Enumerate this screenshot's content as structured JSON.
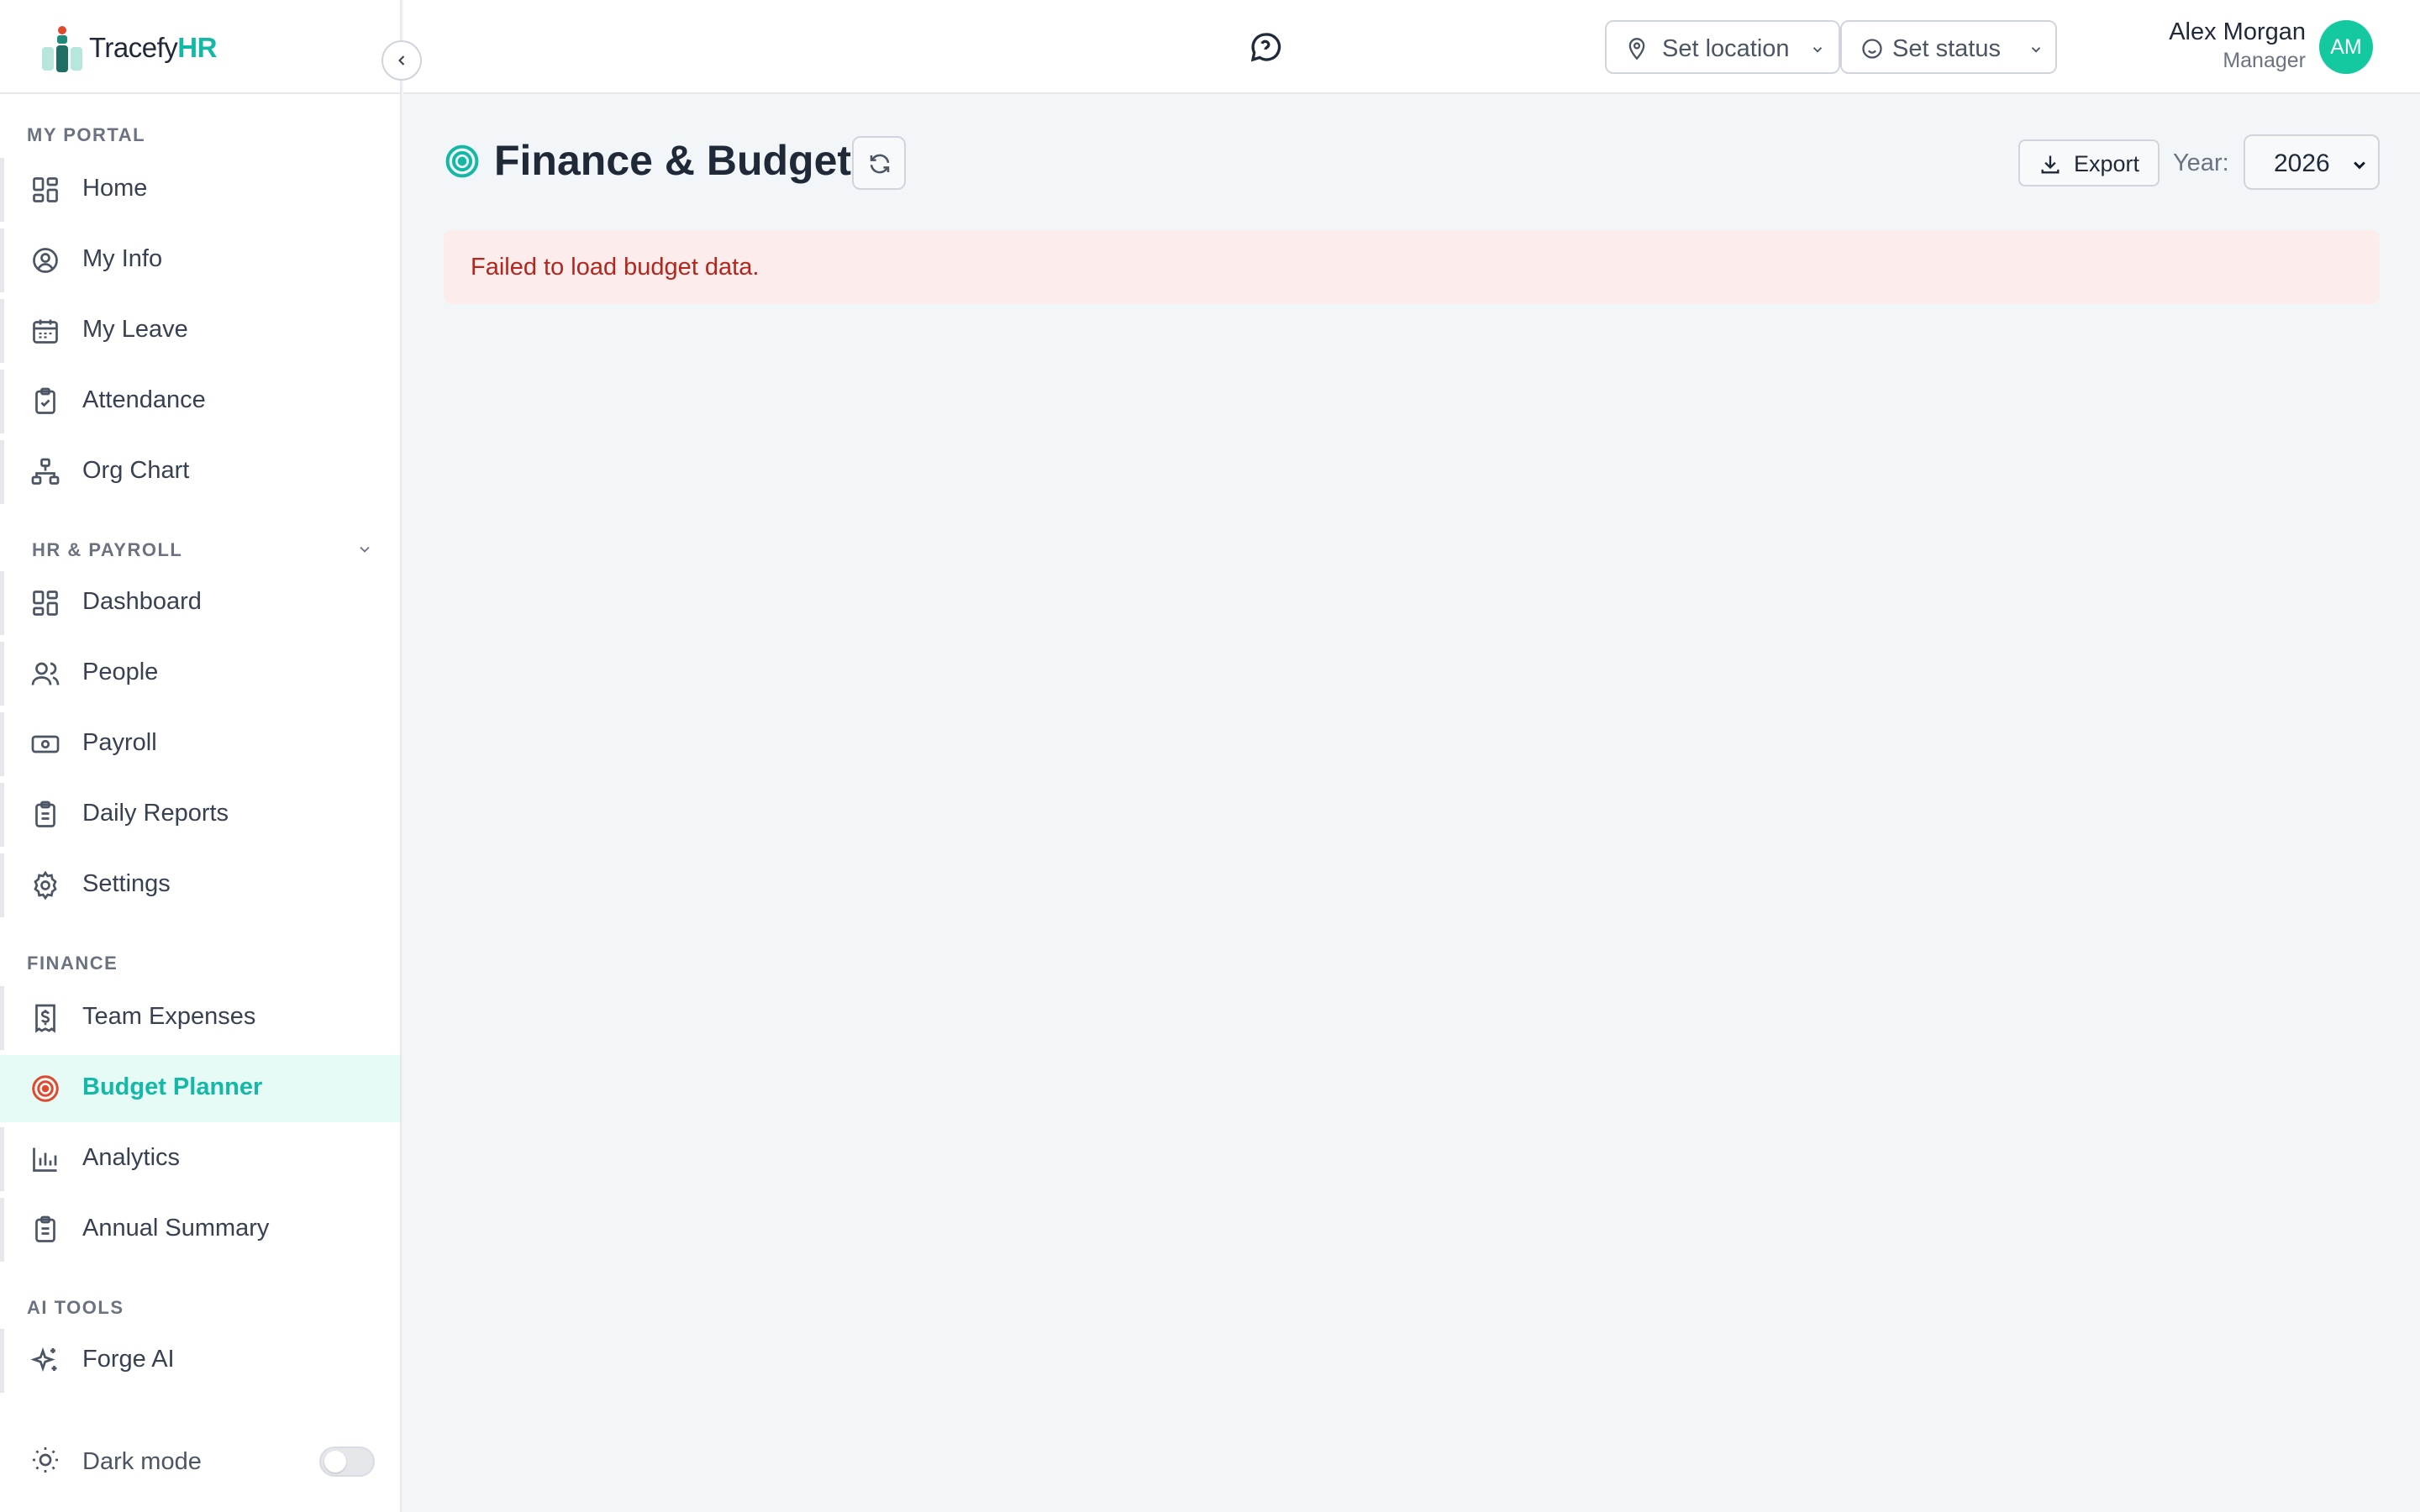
{
  "brand": {
    "name": "Tracefy",
    "suffix": "HR"
  },
  "sidebar": {
    "sections": [
      {
        "label": "MY PORTAL"
      },
      {
        "label": "HR & PAYROLL"
      },
      {
        "label": "FINANCE"
      },
      {
        "label": "AI TOOLS"
      }
    ],
    "items": [
      {
        "label": "Home",
        "icon": "grid-icon"
      },
      {
        "label": "My Info",
        "icon": "user-circle-icon"
      },
      {
        "label": "My Leave",
        "icon": "calendar-icon"
      },
      {
        "label": "Attendance",
        "icon": "clipboard-check-icon"
      },
      {
        "label": "Org Chart",
        "icon": "org-chart-icon"
      },
      {
        "label": "Dashboard",
        "icon": "grid-icon"
      },
      {
        "label": "People",
        "icon": "users-icon"
      },
      {
        "label": "Payroll",
        "icon": "banknote-icon"
      },
      {
        "label": "Daily Reports",
        "icon": "clipboard-list-icon"
      },
      {
        "label": "Settings",
        "icon": "gear-icon"
      },
      {
        "label": "Team Expenses",
        "icon": "receipt-dollar-icon"
      },
      {
        "label": "Budget Planner",
        "icon": "target-icon",
        "active": true
      },
      {
        "label": "Analytics",
        "icon": "bar-chart-icon"
      },
      {
        "label": "Annual Summary",
        "icon": "clipboard-list-icon"
      },
      {
        "label": "Forge AI",
        "icon": "sparkles-icon"
      }
    ],
    "dark_mode": {
      "label": "Dark mode",
      "enabled": false
    }
  },
  "topbar": {
    "location": "Set location",
    "status": "Set status",
    "user": {
      "name": "Alex Morgan",
      "role": "Manager",
      "initials": "AM"
    }
  },
  "main": {
    "title": "Finance & Budget",
    "export_label": "Export",
    "year_label": "Year:",
    "year_value": "2026",
    "error": "Failed to load budget data."
  },
  "colors": {
    "accent": "#14b8a6",
    "error_bg": "#fcecec",
    "error_text": "#b3261e",
    "active_bg": "#e6fbf6",
    "budget_icon": "#e0492f"
  }
}
